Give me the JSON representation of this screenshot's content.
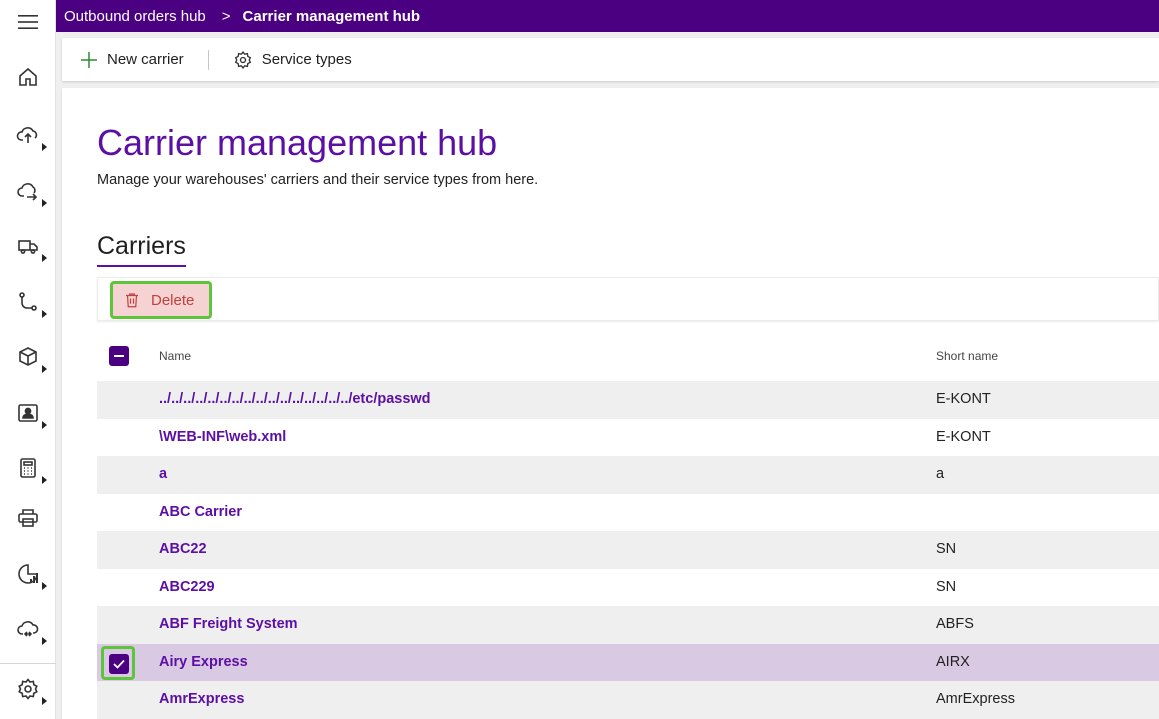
{
  "breadcrumb": {
    "parent": "Outbound orders hub",
    "separator": ">",
    "current": "Carrier management hub"
  },
  "commands": {
    "new_carrier": "New carrier",
    "service_types": "Service types"
  },
  "page": {
    "title": "Carrier management hub",
    "description": "Manage your warehouses' carriers and their service types from here."
  },
  "section": {
    "title": "Carriers",
    "delete_label": "Delete"
  },
  "table": {
    "headers": {
      "name": "Name",
      "short_name": "Short name"
    },
    "rows": [
      {
        "name": "../../../../../../../../../../../../../../../../etc/passwd",
        "short": "E-KONT"
      },
      {
        "name": "\\WEB-INF\\web.xml",
        "short": "E-KONT"
      },
      {
        "name": "a",
        "short": "a"
      },
      {
        "name": "ABC Carrier",
        "short": ""
      },
      {
        "name": "ABC22",
        "short": "SN"
      },
      {
        "name": "ABC229",
        "short": "SN"
      },
      {
        "name": "ABF Freight System",
        "short": "ABFS"
      },
      {
        "name": "Airy Express",
        "short": "AIRX"
      },
      {
        "name": "AmrExpress",
        "short": "AmrExpress"
      }
    ]
  },
  "colors": {
    "brand": "#4b0082",
    "accent_text": "#5c0fa3",
    "highlight_border": "#5ec43a",
    "delete_bg": "#f6d3d3",
    "selected_row": "#d9c9e2"
  },
  "icons": {
    "menu": "hamburger-menu-icon",
    "nav": [
      "home-icon",
      "inbound-icon",
      "outbound-icon",
      "truck-icon",
      "flow-icon",
      "package-icon",
      "person-card-icon",
      "calculator-icon",
      "printer-icon",
      "chart-icon",
      "cloud-sync-icon",
      "settings-icon"
    ]
  }
}
